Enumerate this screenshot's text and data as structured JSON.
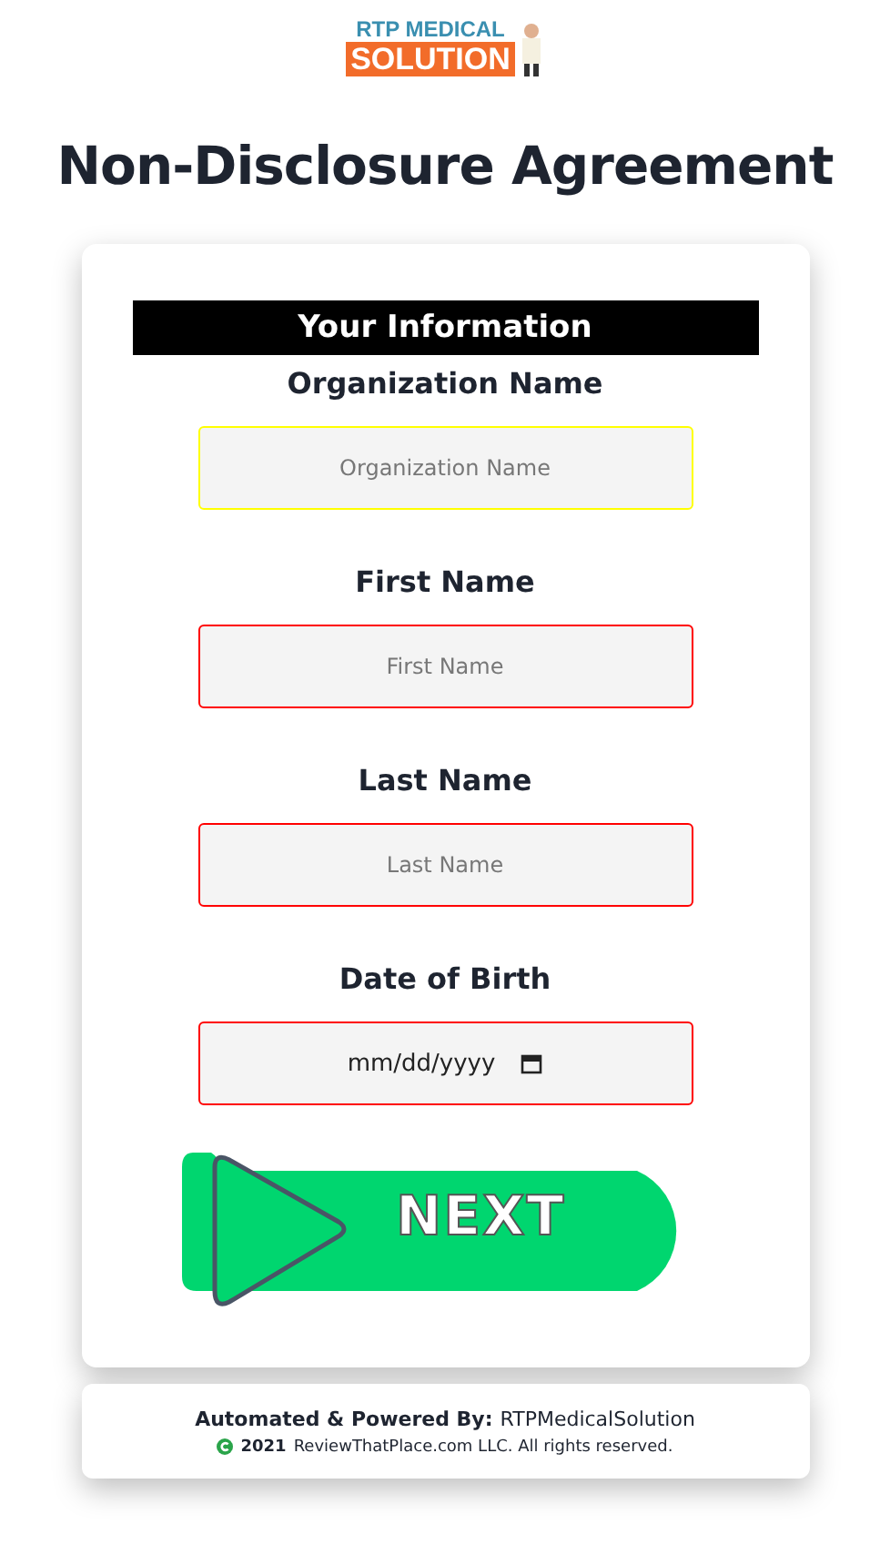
{
  "logo": {
    "line_1": "RTP MEDICAL",
    "line_2": "SOLUTION"
  },
  "title": "Non-Disclosure Agreement",
  "form": {
    "section_title": "Your Information",
    "fields": [
      {
        "kind": "text",
        "label": "Organization Name",
        "placeholder": "Organization Name",
        "color": "#ffff00"
      },
      {
        "kind": "text",
        "label": "First Name",
        "placeholder": "First Name",
        "color": "#ff0000"
      },
      {
        "kind": "text",
        "label": "Last Name",
        "placeholder": "Last Name",
        "color": "#ff0000"
      },
      {
        "kind": "date",
        "label": "Date of Birth",
        "placeholder": "mm/dd/yyyy",
        "color": "#ff0000"
      }
    ],
    "next_button": "NEXT"
  },
  "footer": {
    "powered_label": "Automated & Powered By:",
    "powered_name": "RTPMedicalSolution",
    "copyright_year": "2021",
    "copyright_text": "ReviewThatPlace.com LLC. All rights reserved."
  }
}
